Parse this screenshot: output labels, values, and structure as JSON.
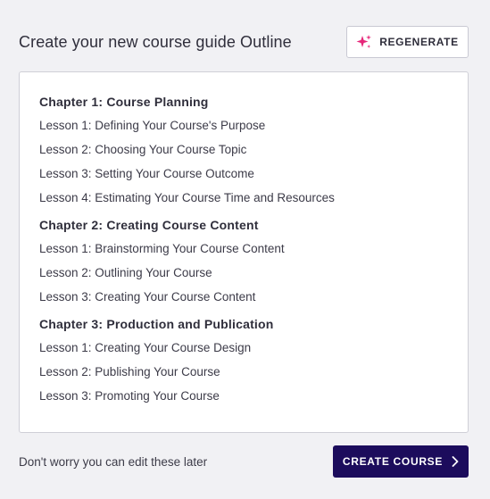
{
  "header": {
    "title": "Create your new course guide Outline",
    "regenerate_label": "REGENERATE",
    "regenerate_icon": "sparkle-icon"
  },
  "outline": {
    "chapters": [
      {
        "title": "Chapter 1: Course Planning",
        "lessons": [
          "Lesson 1: Defining Your Course's Purpose",
          "Lesson 2: Choosing Your Course Topic",
          "Lesson 3: Setting Your Course Outcome",
          "Lesson 4: Estimating Your Course Time and Resources"
        ]
      },
      {
        "title": "Chapter 2: Creating Course Content",
        "lessons": [
          "Lesson 1: Brainstorming Your Course Content",
          "Lesson 2: Outlining Your Course",
          "Lesson 3: Creating Your Course Content"
        ]
      },
      {
        "title": "Chapter 3: Production and Publication",
        "lessons": [
          "Lesson 1: Creating Your Course Design",
          "Lesson 2: Publishing Your Course",
          "Lesson 3: Promoting Your Course"
        ]
      }
    ]
  },
  "footer": {
    "note": "Don't worry you can edit these later",
    "create_label": "CREATE COURSE",
    "create_icon": "chevron-right-icon"
  },
  "colors": {
    "background": "#f1f1f4",
    "primary_button": "#1c0c5c",
    "sparkle": "#e6287a"
  }
}
